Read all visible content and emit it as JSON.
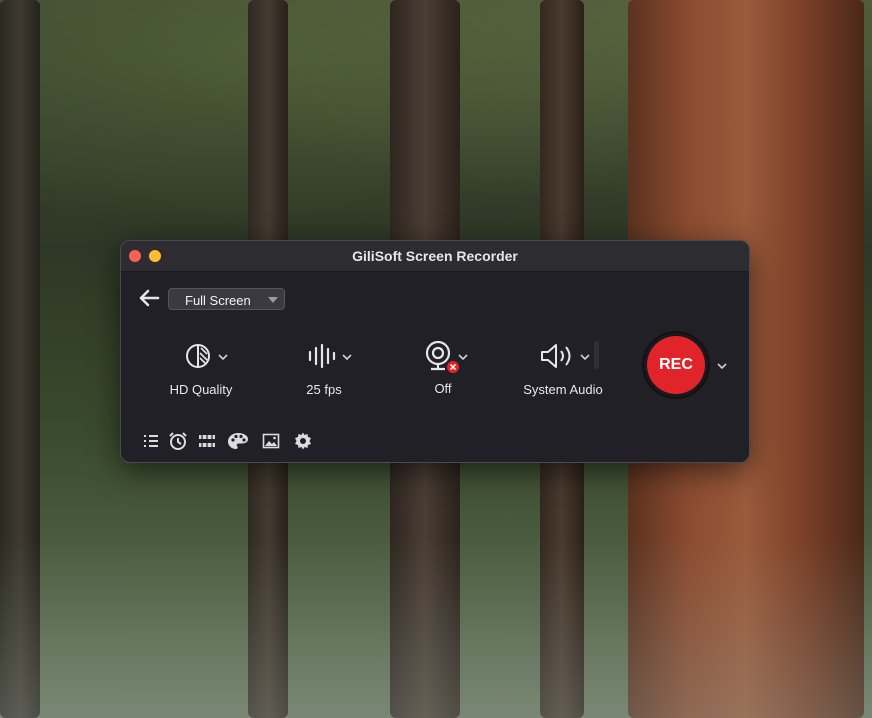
{
  "app": {
    "title": "GiliSoft Screen Recorder"
  },
  "toolbar": {
    "mode_label": "Full Screen"
  },
  "options": {
    "quality_label": "HD Quality",
    "fps_label": "25 fps",
    "webcam_label": "Off",
    "audio_label": "System Audio"
  },
  "record": {
    "label": "REC"
  },
  "colors": {
    "rec_button": "#e0242a",
    "window_bg": "#202026",
    "close_light": "#fe5f57",
    "minimize_light": "#febc2e"
  },
  "icons": [
    "back-arrow-icon",
    "quality-icon",
    "audio-wave-icon",
    "webcam-icon",
    "webcam-off-badge-icon",
    "speaker-icon",
    "list-icon",
    "alarm-clock-icon",
    "film-strip-icon",
    "palette-icon",
    "image-icon",
    "gear-icon",
    "chevron-down-icon"
  ]
}
